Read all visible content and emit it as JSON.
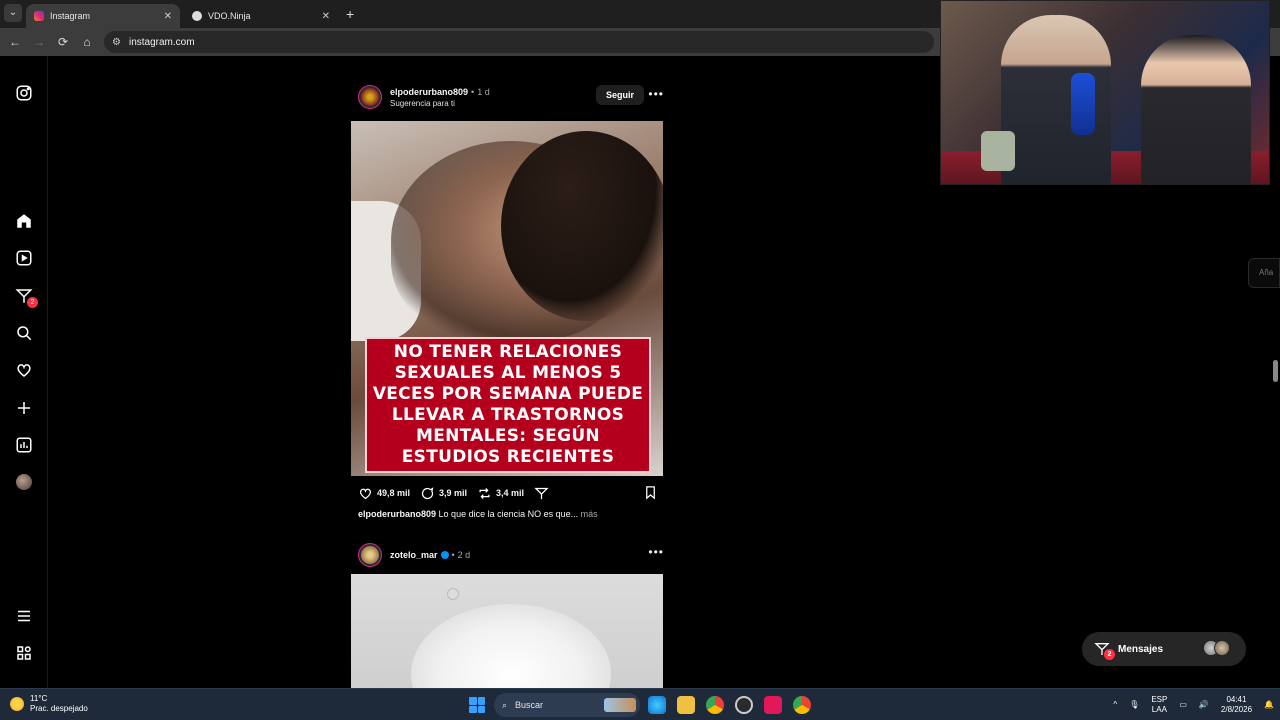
{
  "browser": {
    "tabs": [
      {
        "title": "Instagram",
        "active": true
      },
      {
        "title": "VDO.Ninja",
        "active": false
      }
    ],
    "new_tab_label": "+",
    "url": "instagram.com"
  },
  "ig_nav": {
    "messages_badge": "2"
  },
  "posts": [
    {
      "username": "elpoderurbano809",
      "time": "1 d",
      "subtitle": "Sugerencia para ti",
      "follow_label": "Seguir",
      "image_caption": "NO TENER RELACIONES SEXUALES AL MENOS 5 VECES POR SEMANA PUEDE LLEVAR A TRASTORNOS MENTALES: SEGÚN ESTUDIOS RECIENTES",
      "likes": "49,8 mil",
      "comments": "3,9 mil",
      "reposts": "3,4 mil",
      "caption_user": "elpoderurbano809",
      "caption_text": "Lo que dice la ciencia NO es que...",
      "caption_more": "más"
    },
    {
      "username": "zotelo_mar",
      "time": "2 d"
    }
  ],
  "side_hint": "Aña",
  "messages": {
    "label": "Mensajes",
    "badge": "2"
  },
  "taskbar": {
    "temperature": "11°C",
    "weather": "Prac. despejado",
    "search_label": "Buscar",
    "lang_top": "ESP",
    "lang_bottom": "LAA",
    "time": "04:41",
    "date": "2/8/2026"
  },
  "colors": {
    "background": "#000000",
    "accent_blue": "#0095f6",
    "badge_red": "#ff3040",
    "caption_box": "#b4001c"
  }
}
